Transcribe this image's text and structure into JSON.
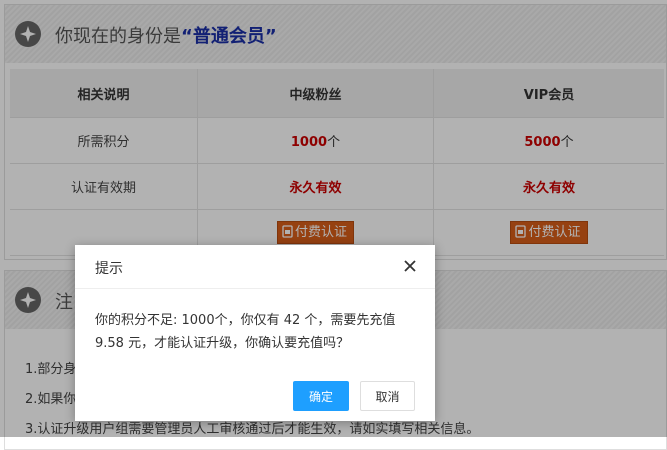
{
  "header": {
    "prefix": "你现在的身份是",
    "identity": "“普通会员”"
  },
  "table": {
    "headers": [
      "相关说明",
      "中级粉丝",
      "VIP会员"
    ],
    "rows": [
      {
        "label": "所需积分",
        "mid_value": "1000",
        "mid_unit": "个",
        "vip_value": "5000",
        "vip_unit": "个"
      },
      {
        "label": "认证有效期",
        "mid_value": "永久有效",
        "vip_value": "永久有效"
      }
    ],
    "pay_button": "付费认证"
  },
  "notes_panel": {
    "title_visible": "注",
    "items": [
      "1.部分身",
      "2.如果你",
      "3.认证升级用户组需要管理员人工审核通过后才能生效，请如实填写相关信息。"
    ]
  },
  "dialog": {
    "title": "提示",
    "message": "你的积分不足: 1000个，你仅有 42 个，需要先充值 9.58 元，才能认证升级，你确认要充值吗？",
    "ok_label": "确定",
    "cancel_label": "取消"
  },
  "colors": {
    "accent_red": "#cc0000",
    "pay_button": "#d75d19",
    "primary_blue": "#1e9fff",
    "identity_blue": "#1a2fa6"
  }
}
